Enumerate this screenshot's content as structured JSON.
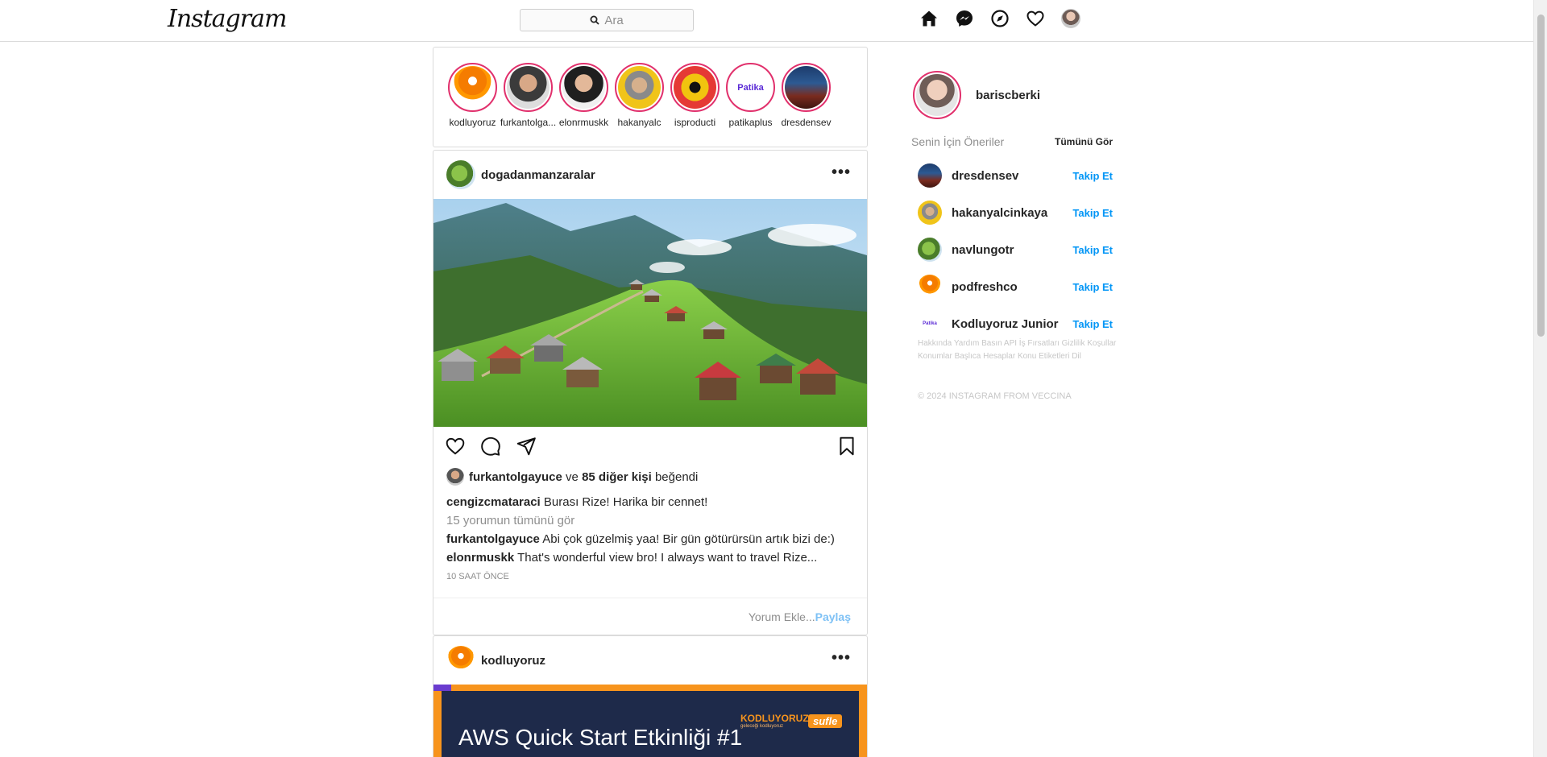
{
  "header": {
    "logo": "Instagram",
    "search_placeholder": "Ara"
  },
  "stories": [
    {
      "name": "kodluyoruz",
      "pic": "rocket"
    },
    {
      "name": "furkantolga...",
      "pic": "man1"
    },
    {
      "name": "elonrmuskk",
      "pic": "man2"
    },
    {
      "name": "hakanyalc",
      "pic": "man3"
    },
    {
      "name": "isproducti",
      "pic": "masc"
    },
    {
      "name": "patikaplus",
      "pic": "patika"
    },
    {
      "name": "dresdensev",
      "pic": "tower"
    }
  ],
  "post1": {
    "user": "dogadanmanzaralar",
    "more": "•••",
    "liked_by_user": "furkantolgayuce",
    "liked_by_connector": "ve",
    "liked_by_count": "85 diğer kişi",
    "liked_by_suffix": "beğendi",
    "caption_user": "cengizcmataraci",
    "caption_text": "Burası Rize! Harika bir cennet!",
    "view_comments": "15 yorumun tümünü gör",
    "comments": [
      {
        "user": "furkantolgayuce",
        "text": "Abi çok güzelmiş yaa! Bir gün götürürsün artık bizi de:)"
      },
      {
        "user": "elonrmuskk",
        "text": "That's wonderful view bro! I always want to travel Rize..."
      }
    ],
    "time": "10 SAAT ÖNCE",
    "comment_placeholder": "Yorum Ekle...",
    "share_label": "Paylaş"
  },
  "post2": {
    "user": "kodluyoruz",
    "more": "•••",
    "banner_title": "AWS Quick Start Etkinliği #1",
    "banner_brand": "KODLUYORUZ",
    "banner_brand_tag": "geleceği kodluyoruz",
    "banner_partner": "sufle"
  },
  "sidebar": {
    "me": "bariscberki",
    "suggestions_title": "Senin İçin Öneriler",
    "see_all": "Tümünü Gör",
    "follow_label": "Takip Et",
    "suggestions": [
      {
        "name": "dresdensev",
        "pic": "tower"
      },
      {
        "name": "hakanyalcinkaya",
        "pic": "man3"
      },
      {
        "name": "navlungotr",
        "pic": "nature"
      },
      {
        "name": "podfreshco",
        "pic": "rocket"
      },
      {
        "name": "Kodluyoruz Junior",
        "pic": "patika"
      }
    ],
    "footer_links": "Hakkında Yardım Basın API İş Fırsatları Gizlilik Koşullar Konumlar Başlıca Hesaplar Konu Etiketleri Dil",
    "copyright": "© 2024 INSTAGRAM FROM VECCINA"
  },
  "colors": {
    "accent_blue": "#0095f6",
    "story_ring": "#e1306c",
    "share_light_blue": "#7ec1f5"
  }
}
